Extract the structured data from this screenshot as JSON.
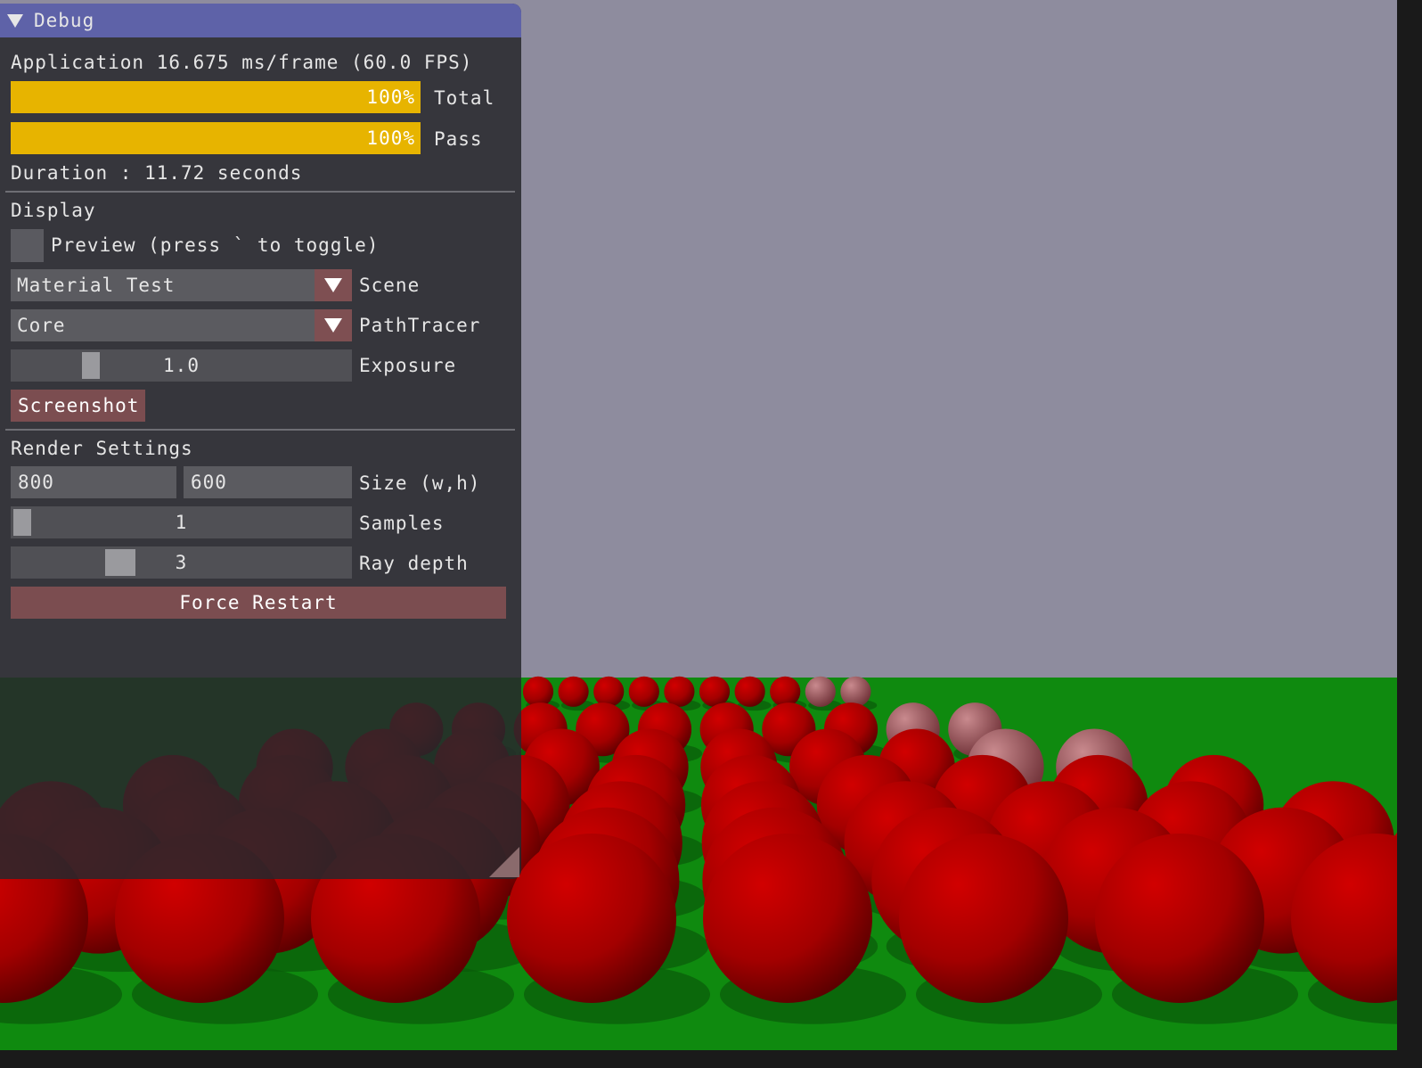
{
  "window": {
    "title": "Debug",
    "stats_text": "Application 16.675 ms/frame (60.0 FPS)",
    "progress_bars": [
      {
        "percent_label": "100%",
        "label": "Total",
        "fraction": 1.0
      },
      {
        "percent_label": "100%",
        "label": "Pass",
        "fraction": 1.0
      }
    ],
    "duration_text": "Duration : 11.72 seconds"
  },
  "display": {
    "header": "Display",
    "preview_checkbox": {
      "label": "Preview (press ` to toggle)",
      "checked": false
    },
    "scene_combo": {
      "value": "Material Test",
      "label": "Scene"
    },
    "pathtracer_combo": {
      "value": "Core",
      "label": "PathTracer"
    },
    "exposure_slider": {
      "value": "1.0",
      "label": "Exposure",
      "fraction": 0.25
    },
    "screenshot_button": "Screenshot"
  },
  "render_settings": {
    "header": "Render Settings",
    "size": {
      "width": "800",
      "height": "600",
      "label": "Size (w,h)"
    },
    "samples_slider": {
      "value": "1",
      "label": "Samples",
      "fraction": 0.0
    },
    "ray_depth_slider": {
      "value": "3",
      "label": "Ray depth",
      "fraction": 0.33
    },
    "force_restart_button": "Force Restart"
  },
  "colors": {
    "title_bar": "#5e62a8",
    "progress_fill": "#e7b400",
    "button": "#7b4d50",
    "sky": "#8e8c9e",
    "ground": "#0f8a0f",
    "sphere": "#b00000"
  }
}
